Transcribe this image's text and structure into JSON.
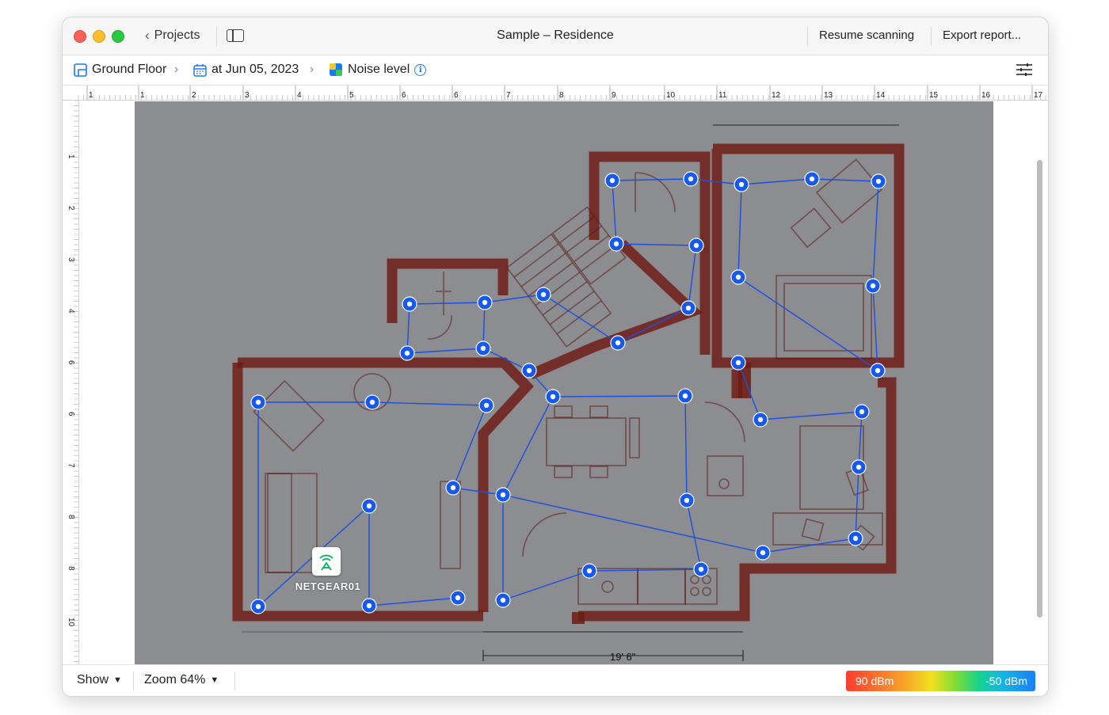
{
  "window": {
    "title": "Sample – Residence",
    "back_label": "Projects",
    "actions": {
      "resume": "Resume scanning",
      "export": "Export report..."
    }
  },
  "breadcrumb": {
    "floor": "Ground Floor",
    "date": "at Jun 05, 2023",
    "metric": "Noise level"
  },
  "ruler": {
    "top_labels": [
      "1",
      "1",
      "2",
      "3",
      "4",
      "5",
      "6",
      "6",
      "7",
      "8",
      "9",
      "10",
      "11",
      "12",
      "13",
      "14",
      "15",
      "16",
      "17"
    ],
    "left_labels": [
      "1",
      "2",
      "3",
      "4",
      "6",
      "6",
      "7",
      "8",
      "8",
      "10",
      "11"
    ]
  },
  "floorplan": {
    "access_point_name": "NETGEAR01",
    "dimension_label": "19' 6\""
  },
  "bottom": {
    "show_label": "Show",
    "zoom_label": "Zoom 64%",
    "legend_min": "90 dBm",
    "legend_max": "-50 dBm"
  },
  "colors": {
    "accent": "#1a7bf0",
    "scan_point": "#1559f0",
    "heat_hot": "#fb4b3a",
    "heat_mid": "#f6d531",
    "heat_cool": "#3cd966",
    "wall": "#6e1a14"
  },
  "icons": {
    "back": "chevron-left-icon",
    "sidebar": "sidebar-icon",
    "floor": "floor-plan-icon",
    "date": "calendar-icon",
    "metric": "noise-level-icon",
    "info": "info-icon",
    "settings": "sliders-icon",
    "ap": "wifi-router-icon"
  }
}
